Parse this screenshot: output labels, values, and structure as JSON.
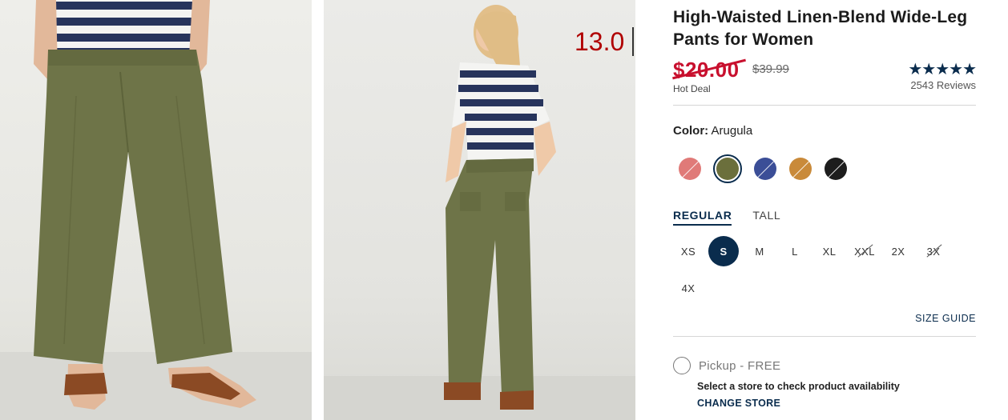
{
  "overlay": {
    "text": "13.0"
  },
  "product": {
    "title": "High-Waisted Linen-Blend Wide-Leg Pants for Women",
    "sale_price": "$20.00",
    "original_price": "$39.99",
    "deal_label": "Hot Deal",
    "stars": "★★★★★",
    "rating_out_of_5": 4.5,
    "reviews": "2543 Reviews"
  },
  "color": {
    "label": "Color:",
    "selected": "Arugula",
    "swatches": [
      {
        "color": "#e07a78",
        "selected": false,
        "available": false
      },
      {
        "color": "#6b6f3c",
        "selected": true,
        "available": true
      },
      {
        "color": "#3b4e97",
        "selected": false,
        "available": false
      },
      {
        "color": "#c98a3a",
        "selected": false,
        "available": false
      },
      {
        "color": "#1d1d1d",
        "selected": false,
        "available": false
      }
    ]
  },
  "fit": {
    "tabs": [
      "REGULAR",
      "TALL"
    ],
    "active": "REGULAR"
  },
  "sizes": {
    "items": [
      {
        "label": "XS",
        "selected": false,
        "available": true
      },
      {
        "label": "S",
        "selected": true,
        "available": true
      },
      {
        "label": "M",
        "selected": false,
        "available": true
      },
      {
        "label": "L",
        "selected": false,
        "available": true
      },
      {
        "label": "XL",
        "selected": false,
        "available": true
      },
      {
        "label": "XXL",
        "selected": false,
        "available": false
      },
      {
        "label": "2X",
        "selected": false,
        "available": true
      },
      {
        "label": "3X",
        "selected": false,
        "available": false
      },
      {
        "label": "4X",
        "selected": false,
        "available": true
      }
    ],
    "size_guide": "SIZE GUIDE"
  },
  "fulfillment": {
    "pickup_label": "Pickup - FREE",
    "store_note": "Select a store to check product availability",
    "change_store": "CHANGE STORE"
  },
  "colors": {
    "accent": "#0a2c4d",
    "sale": "#c8102e",
    "pants": "#6e7448",
    "shirt_navy": "#27345c"
  }
}
